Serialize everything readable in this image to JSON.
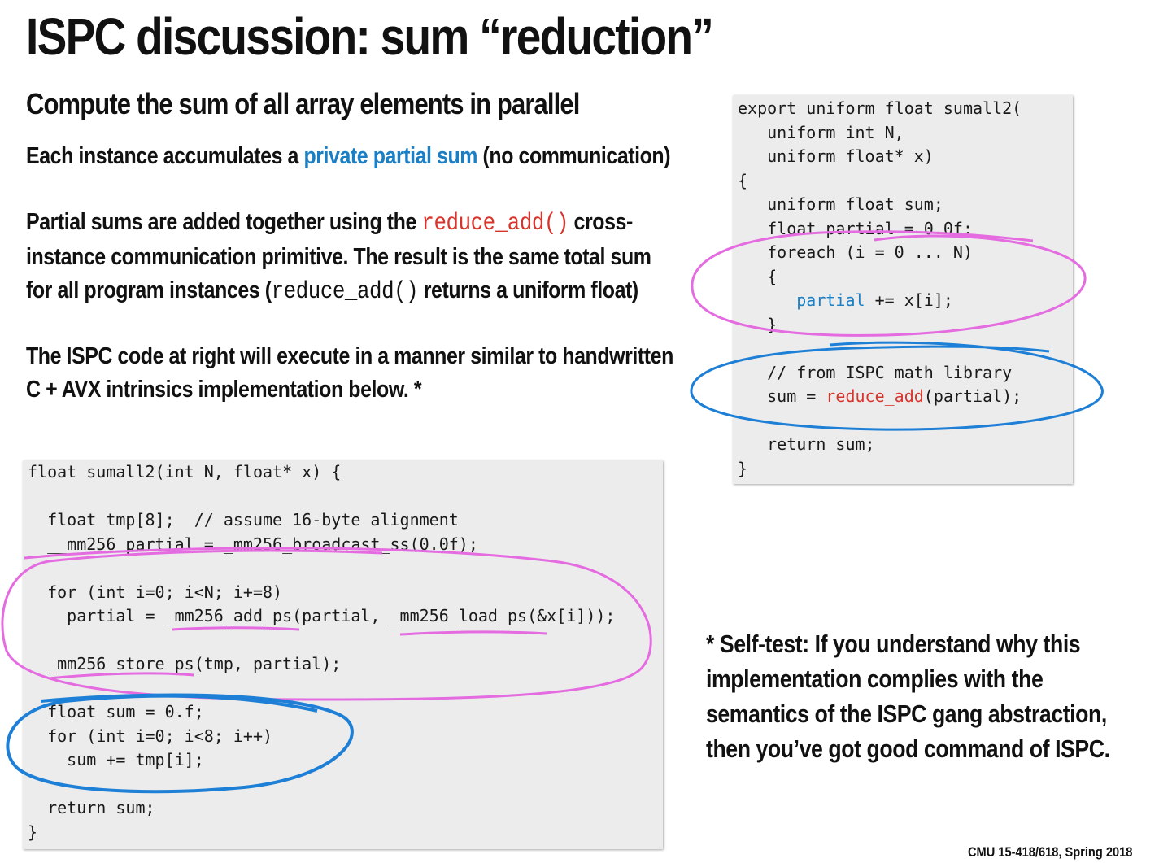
{
  "title": "ISPC discussion: sum “reduction”",
  "subtitle": "Compute the sum of all array elements in parallel",
  "para1": {
    "before": "Each instance accumulates a ",
    "highlight": "private partial sum",
    "after": " (no communication)"
  },
  "para2": {
    "line1_before": "Partial sums are added together using the ",
    "line1_code": "reduce_add()",
    "line1_after": " cross-",
    "line2": "instance communication primitive.  The result is the same total sum",
    "line3_before": "for all program instances (",
    "line3_code": "reduce_add()",
    "line3_after": " returns a uniform float)"
  },
  "para3": {
    "line1": "The ISPC code at right will execute in a manner similar to handwritten",
    "line2": "C + AVX intrinsics implementation below. *"
  },
  "ispc_code": {
    "l1": "export uniform float sumall2(",
    "l2": "   uniform int N,",
    "l3": "   uniform float* x)",
    "l4": "{",
    "l5": "   uniform float sum;",
    "l6": "   float partial = 0.0f;",
    "l7": "   foreach (i = 0 ... N)",
    "l8": "   {",
    "l9_indent": "      ",
    "l9_var": "partial",
    "l9_rest": " += x[i];",
    "l10": "   }",
    "l11": "",
    "l12": "   // from ISPC math library",
    "l13_before": "   sum = ",
    "l13_fn": "reduce_add",
    "l13_after": "(partial);",
    "l14": "",
    "l15": "   return sum;",
    "l16": "}"
  },
  "c_code": {
    "l1": "float sumall2(int N, float* x) {",
    "l2": "",
    "l3": "  float tmp[8];  // assume 16-byte alignment",
    "l4": "  __mm256 partial = _mm256_broadcast_ss(0.0f);",
    "l5": "",
    "l6": "  for (int i=0; i<N; i+=8)",
    "l7": "    partial = _mm256_add_ps(partial, _mm256_load_ps(&x[i]));",
    "l8": "",
    "l9": "  _mm256_store_ps(tmp, partial);",
    "l10": "",
    "l11": "  float sum = 0.f;",
    "l12": "  for (int i=0; i<8; i++)",
    "l13": "    sum += tmp[i];",
    "l14": "",
    "l15": "  return sum;",
    "l16": "}"
  },
  "selftest": {
    "line1": "* Self-test: If you understand why this",
    "line2": "implementation complies with the",
    "line3": "semantics of the ISPC gang abstraction,",
    "line4": "then you’ve got good command of ISPC."
  },
  "footer": "CMU 15-418/618, Spring 2018",
  "colors": {
    "accent_blue": "#1a7fc4",
    "accent_red": "#d9342b",
    "annotation_pink": "#e46be0",
    "annotation_blue": "#1e7fd6"
  }
}
